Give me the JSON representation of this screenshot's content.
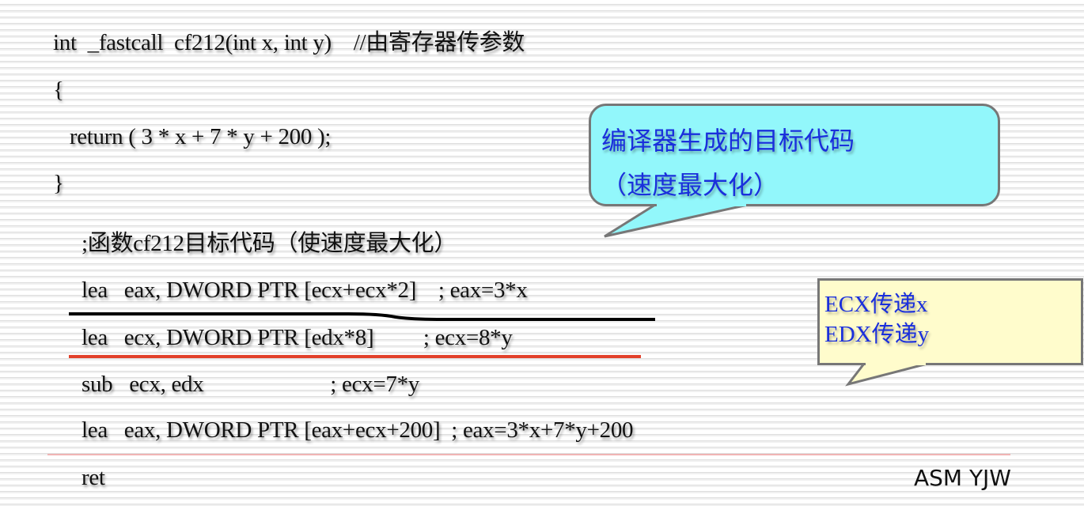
{
  "slide": {
    "c_code": [
      "int  _fastcall  cf212(int x, int y)    //由寄存器传参数",
      "{",
      "   return ( 3 * x + 7 * y + 200 );",
      "}"
    ],
    "asm_comment": ";函数cf212目标代码（使速度最大化）",
    "asm_lines": [
      "lea   eax, DWORD PTR [ecx+ecx*2]    ; eax=3*x",
      "lea   ecx, DWORD PTR [edx*8]         ; ecx=8*y",
      "sub   ecx, edx                       ; ecx=7*y",
      "lea   eax, DWORD PTR [eax+ecx+200]  ; eax=3*x+7*y+200",
      "ret"
    ],
    "callout_compiler": [
      "编译器生成的目标代码",
      "（速度最大化）"
    ],
    "callout_registers": [
      "ECX传递x",
      "EDX传递y"
    ],
    "footer_mark": "ASM YJW"
  },
  "colors": {
    "callout_blue_fill": "#92f7fb",
    "callout_yellow_fill": "#fffccc",
    "callout_text": "#1a2fdc",
    "underline_black": "#000000",
    "underline_red": "#e2402a",
    "divider_red": "#f0a0a0"
  }
}
